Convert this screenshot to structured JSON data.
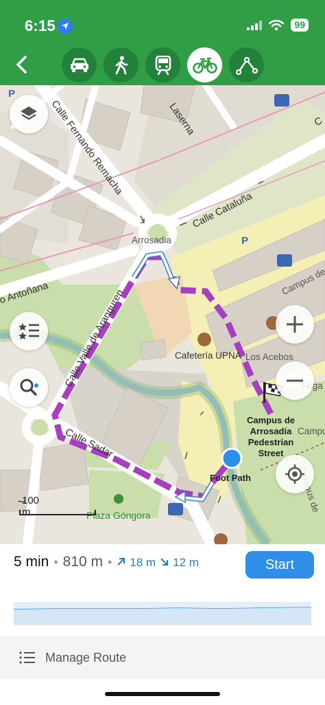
{
  "status_bar": {
    "time": "6:15",
    "battery": "99"
  },
  "header": {
    "back_icon": "chevron-left-icon",
    "modes": [
      {
        "name": "car",
        "icon": "car-icon",
        "active": false
      },
      {
        "name": "walk",
        "icon": "pedestrian-icon",
        "active": false
      },
      {
        "name": "transit",
        "icon": "train-icon",
        "active": false
      },
      {
        "name": "bike",
        "icon": "bicycle-icon",
        "active": true
      },
      {
        "name": "route",
        "icon": "route-icon",
        "active": false
      }
    ]
  },
  "map": {
    "streets": {
      "fernando": "Calle Fernando Remacha",
      "laserna": "Laserna",
      "cataluna": "Calle Cataluña",
      "antonana": "o Antoñana",
      "aranguren": "Calle Valle de Aranguren",
      "sadar": "Calle Sadar",
      "campus_e": "Campus de",
      "campus_vert": "Campus de",
      "c": "C"
    },
    "places": {
      "arrosadia": "Arrosadia",
      "cafeteria": "Cafetería UPNA",
      "acebos": "Los Acebos",
      "fuga": "Fuga",
      "campus_mag": "Campus Mag",
      "plaza": "Plaza Góngora",
      "destination": "Campus de Arrosadía Pedestrian Street",
      "foot_path": "Foot Path",
      "parking": "P",
      "l_fragment": "L"
    },
    "scale_label": "100 m",
    "controls": {
      "layers_icon": "layers-icon",
      "poi_icon": "star-list-icon",
      "search_icon": "search-icon",
      "zoom_in_icon": "plus-icon",
      "zoom_out_icon": "minus-icon",
      "locate_icon": "locate-icon"
    }
  },
  "route_summary": {
    "time": "5 min",
    "separator": "•",
    "distance": "810 m",
    "ascent": "18 m",
    "descent": "12 m",
    "start_label": "Start"
  },
  "manage_route": {
    "label": "Manage Route",
    "icon": "list-icon"
  },
  "colors": {
    "header": "#2f9e47",
    "route": "#a640c0",
    "accent": "#2e8ee8"
  }
}
